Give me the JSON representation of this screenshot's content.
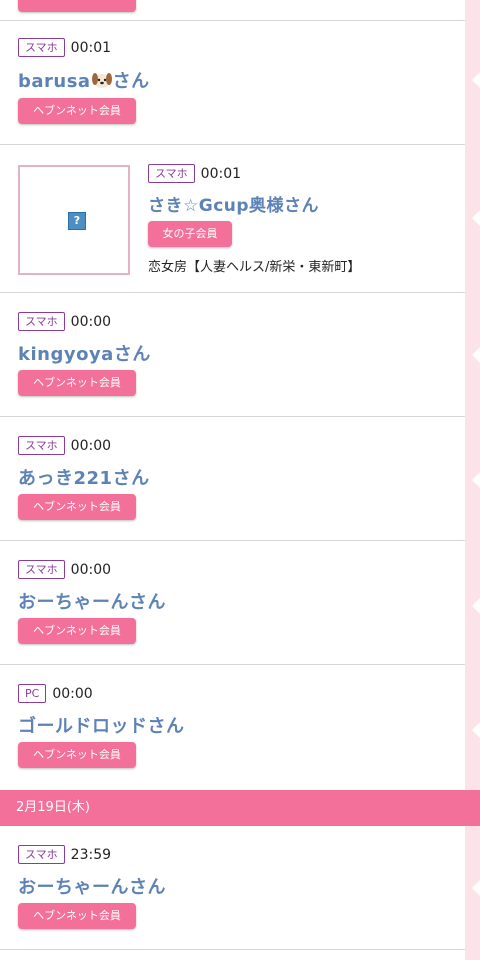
{
  "entries": [
    {
      "device": "スマホ",
      "time": "00:01",
      "name": "barusa",
      "name_suffix": "さん",
      "icon": "dog-face-emoji",
      "badge": "ヘブンネット会員"
    },
    {
      "device": "スマホ",
      "time": "00:01",
      "name": "さき☆Gcup奥様さん",
      "badge": "女の子会員",
      "shop": "恋女房【人妻ヘルス/新栄・東新町】",
      "thumb_icon": "?"
    },
    {
      "device": "スマホ",
      "time": "00:00",
      "name": "kingyoyaさん",
      "badge": "ヘブンネット会員"
    },
    {
      "device": "スマホ",
      "time": "00:00",
      "name": "あっき221さん",
      "badge": "ヘブンネット会員"
    },
    {
      "device": "スマホ",
      "time": "00:00",
      "name": "おーちゃーんさん",
      "badge": "ヘブンネット会員"
    },
    {
      "device": "PC",
      "time": "00:00",
      "name": "ゴールドロッドさん",
      "badge": "ヘブンネット会員"
    },
    {
      "device": "スマホ",
      "time": "23:59",
      "name": "おーちゃーんさん",
      "badge": "ヘブンネット会員"
    }
  ],
  "date_header": "2月19日(木)",
  "colors": {
    "accent": "#f2709a",
    "name": "#5d83b6",
    "device_border": "#8a3d98",
    "sidebar": "#fbe3e8"
  }
}
